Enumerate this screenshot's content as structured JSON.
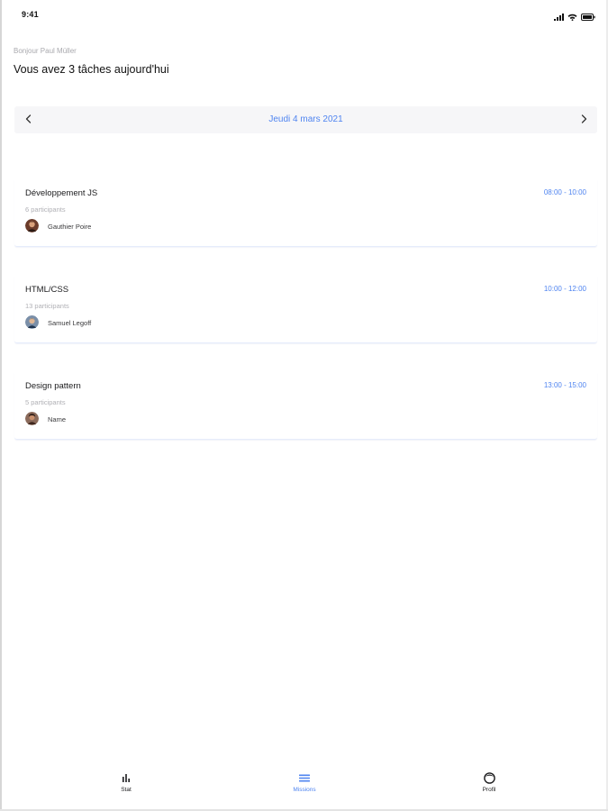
{
  "status_bar": {
    "time": "9:41"
  },
  "header": {
    "greeting": "Bonjour Paul Müller",
    "headline": "Vous avez 3 tâches aujourd'hui"
  },
  "date_nav": {
    "label": "Jeudi 4 mars 2021"
  },
  "missions": [
    {
      "title": "Développement JS",
      "time": "08:00 - 10:00",
      "participants": "6 participants",
      "host": "Gauthier Poire"
    },
    {
      "title": "HTML/CSS",
      "time": "10:00 - 12:00",
      "participants": "13 participants",
      "host": "Samuel Legoff"
    },
    {
      "title": "Design pattern",
      "time": "13:00 - 15:00",
      "participants": "5 participants",
      "host": "Name"
    }
  ],
  "tabs": [
    {
      "label": "Stat",
      "icon": "bar-chart-icon",
      "active": false
    },
    {
      "label": "Missions",
      "icon": "list-icon",
      "active": true
    },
    {
      "label": "Profil",
      "icon": "profile-icon",
      "active": false
    }
  ],
  "colors": {
    "accent": "#4f84f0",
    "muted": "#b0b0b5",
    "date_bar_bg": "#f6f6f8"
  }
}
